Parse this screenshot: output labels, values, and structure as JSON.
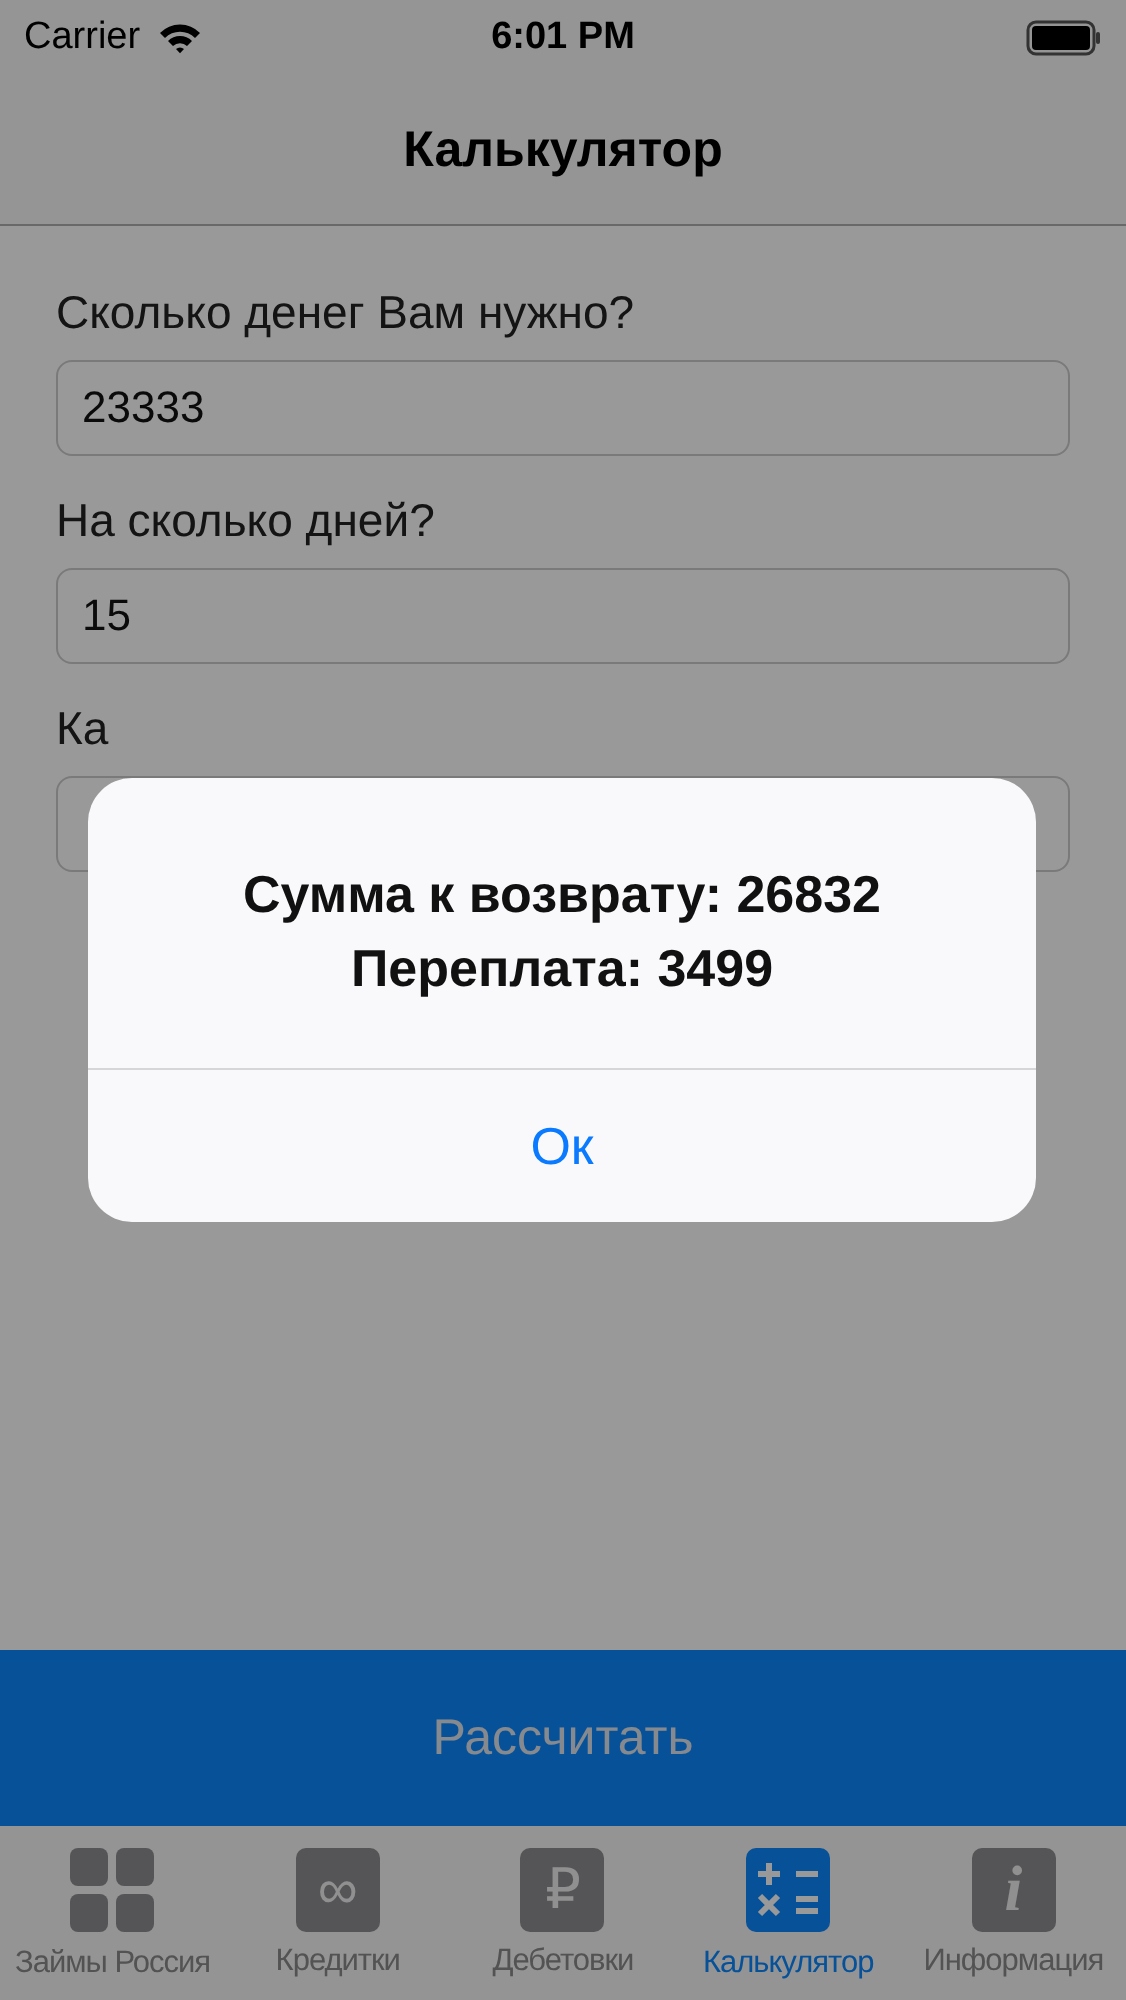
{
  "status_bar": {
    "carrier": "Carrier",
    "time": "6:01 PM"
  },
  "nav_bar": {
    "title": "Калькулятор"
  },
  "fields": [
    {
      "label": "Сколько денег Вам нужно?",
      "value": "23333"
    },
    {
      "label": "На сколько дней?",
      "value": "15"
    },
    {
      "label": "Ка"
    }
  ],
  "calculate_button": {
    "label": "Рассчитать"
  },
  "tabs": [
    {
      "label": "Займы Россия",
      "kind": "grid",
      "selected": false
    },
    {
      "label": "Кредитки",
      "kind": "glyph",
      "glyph": "∞",
      "selected": false
    },
    {
      "label": "Дебетовки",
      "kind": "glyph",
      "glyph": "₽",
      "selected": false
    },
    {
      "label": "Калькулятор",
      "kind": "calculator",
      "selected": true
    },
    {
      "label": "Информация",
      "kind": "info",
      "glyph": "i",
      "selected": false
    }
  ],
  "alert": {
    "lines": [
      "Сумма к возврату: 26832",
      "Переплата: 3499"
    ],
    "button": "Ок"
  }
}
